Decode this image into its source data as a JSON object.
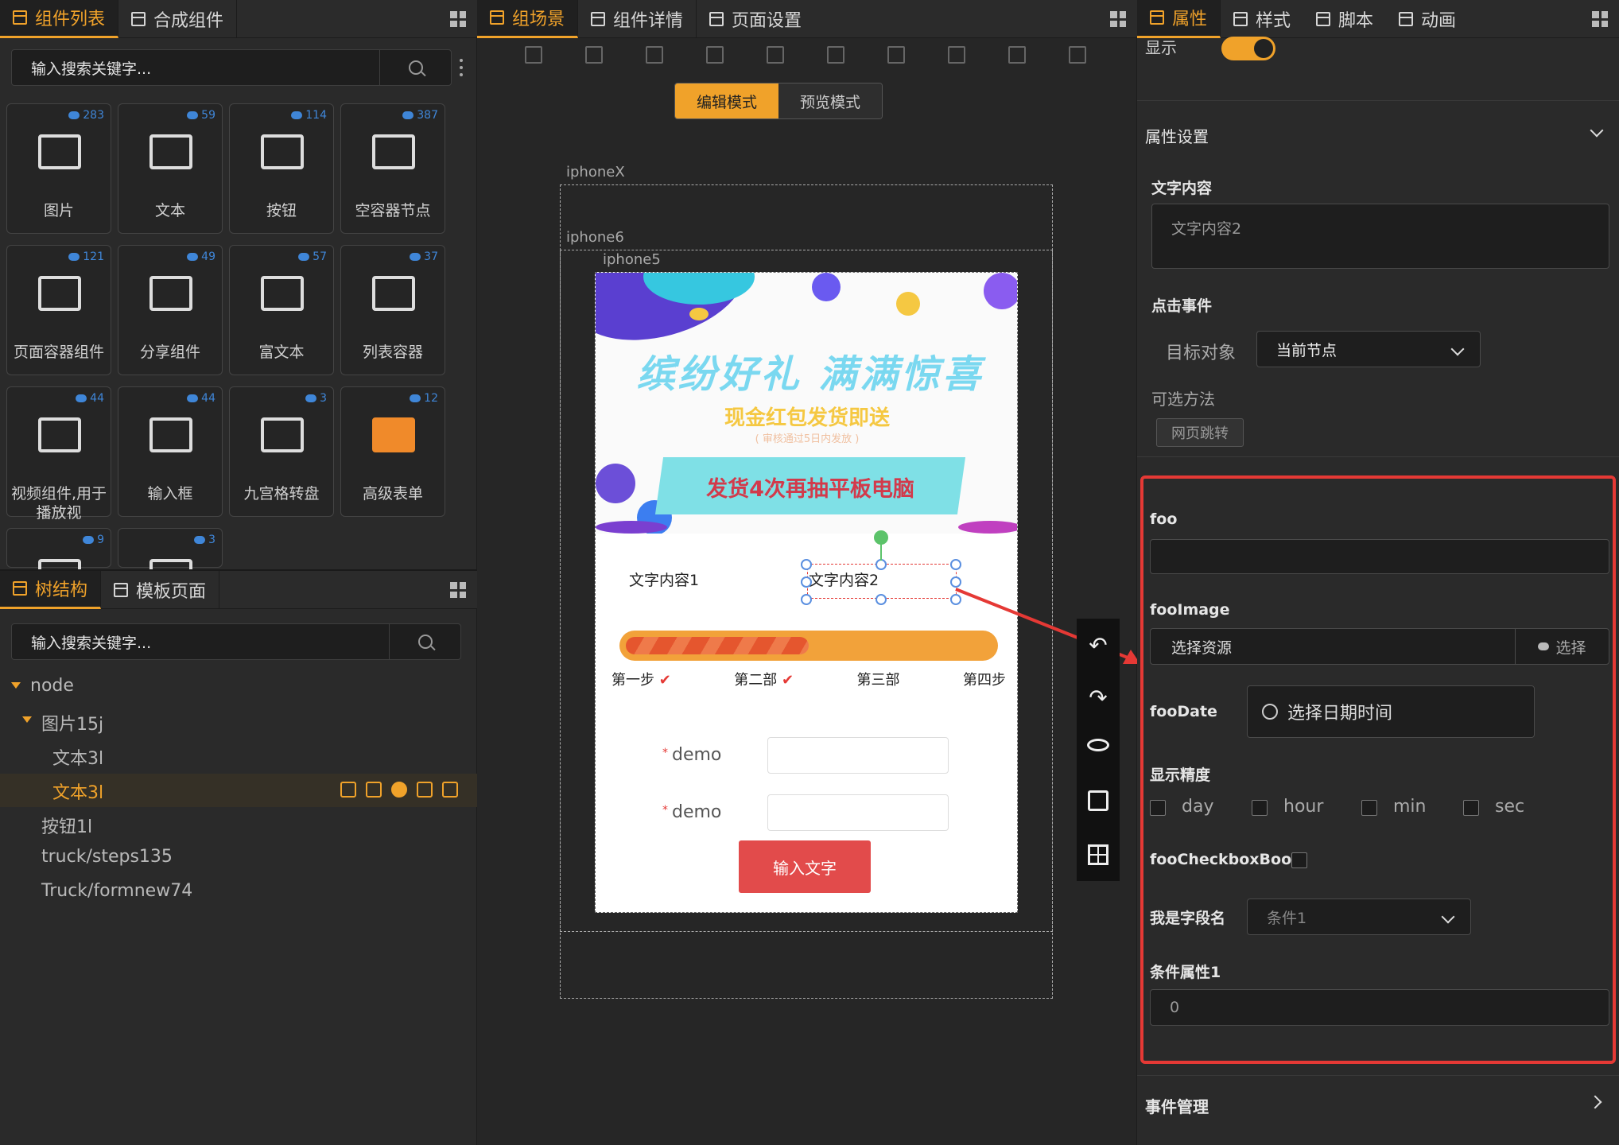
{
  "left_top": {
    "tabs": [
      {
        "label": "组件列表"
      },
      {
        "label": "合成组件"
      }
    ],
    "search_placeholder": "输入搜索关键字...",
    "components": [
      {
        "name": "图片",
        "count": "283",
        "icon": "image-icon"
      },
      {
        "name": "文本",
        "count": "59",
        "icon": "text-icon"
      },
      {
        "name": "按钮",
        "count": "114",
        "icon": "pointer-hand-icon"
      },
      {
        "name": "空容器节点",
        "count": "387",
        "icon": "empty-box-icon"
      },
      {
        "name": "页面容器组件",
        "count": "121",
        "icon": "document-icon"
      },
      {
        "name": "分享组件",
        "count": "49",
        "icon": "share-icon"
      },
      {
        "name": "富文本",
        "count": "57",
        "icon": "rich-text-icon"
      },
      {
        "name": "列表容器",
        "count": "37",
        "icon": "list-icon"
      },
      {
        "name": "视频组件,用于播放视",
        "count": "44",
        "icon": "video-camera-icon"
      },
      {
        "name": "输入框",
        "count": "44",
        "icon": "pencil-icon"
      },
      {
        "name": "九宫格转盘",
        "count": "3",
        "icon": "grid-nine-icon"
      },
      {
        "name": "高级表单",
        "count": "12",
        "icon": "form-edit-icon"
      },
      {
        "name": "",
        "count": "9",
        "icon": "speaker-icon"
      },
      {
        "name": "",
        "count": "3",
        "icon": "chart-icon"
      }
    ]
  },
  "left_bottom": {
    "tabs": [
      {
        "label": "树结构"
      },
      {
        "label": "模板页面"
      }
    ],
    "search_placeholder": "输入搜索关键字...",
    "tree": [
      {
        "label": "node",
        "level": 0,
        "expanded": true
      },
      {
        "label": "图片15j",
        "level": 1,
        "expanded": true
      },
      {
        "label": "文本3l",
        "level": 2
      },
      {
        "label": "文本3l",
        "level": 2,
        "selected": true
      },
      {
        "label": "按钮1l",
        "level": 1
      },
      {
        "label": "truck/steps135",
        "level": 1
      },
      {
        "label": "Truck/formnew74",
        "level": 1
      }
    ]
  },
  "center": {
    "tabs": [
      {
        "label": "组场景"
      },
      {
        "label": "组件详情"
      },
      {
        "label": "页面设置"
      }
    ],
    "mode_edit": "编辑模式",
    "mode_preview": "预览模式",
    "device_x": "iphoneX",
    "device_6": "iphone6",
    "device_5": "iphone5",
    "banner_title": "缤纷好礼 满满惊喜",
    "banner_sub": "现金红包发货即送",
    "banner_note": "( 审核通过5日内发放 )",
    "banner_cta": "发货4次再抽平板电脑",
    "text1": "文字内容1",
    "text2": "文字内容2",
    "steps": [
      "第一步",
      "第二部",
      "第三部",
      "第四步"
    ],
    "progress": 0.5,
    "form_label1": "demo",
    "form_label2": "demo",
    "submit": "输入文字"
  },
  "right": {
    "tabs": [
      {
        "label": "属性"
      },
      {
        "label": "样式"
      },
      {
        "label": "脚本"
      },
      {
        "label": "动画"
      }
    ],
    "show_label": "显示",
    "section_props": "属性设置",
    "text_content_label": "文字内容",
    "text_content_placeholder": "文字内容2",
    "click_event": "点击事件",
    "target_label": "目标对象",
    "target_value": "当前节点",
    "methods_label": "可选方法",
    "method_tag": "网页跳转",
    "foo": "foo",
    "fooImage": "fooImage",
    "select_resource": "选择资源",
    "select_btn": "选择",
    "fooDate": "fooDate",
    "date_placeholder": "选择日期时间",
    "precision": "显示精度",
    "precision_opts": [
      "day",
      "hour",
      "min",
      "sec"
    ],
    "fooCheckboxBool": "fooCheckboxBool",
    "field_name": "我是字段名",
    "field_value": "条件1",
    "cond_attr": "条件属性1",
    "cond_value": "0",
    "event_mgmt": "事件管理"
  },
  "colors": {
    "accent": "#f0a22a",
    "highlight": "#e53935",
    "submit": "#e24b4b"
  }
}
